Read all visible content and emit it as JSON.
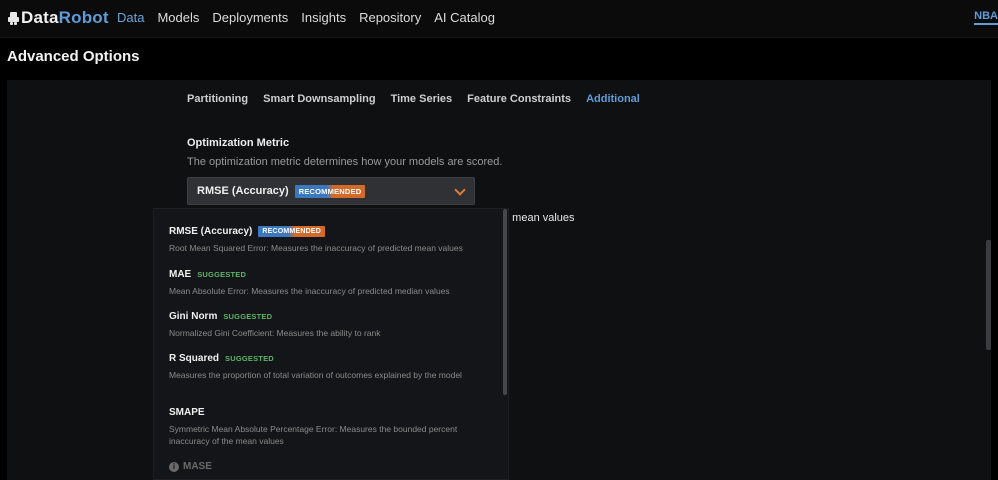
{
  "brand": {
    "part1": "Data",
    "part2": "Robot"
  },
  "nav": [
    "Data",
    "Models",
    "Deployments",
    "Insights",
    "Repository",
    "AI Catalog"
  ],
  "project": "NBA",
  "page_title": "Advanced Options",
  "tabs": [
    "Partitioning",
    "Smart Downsampling",
    "Time Series",
    "Feature Constraints",
    "Additional"
  ],
  "metric": {
    "label": "Optimization Metric",
    "description": "The optimization metric determines how your models are scored.",
    "selected": "RMSE (Accuracy)",
    "selected_badge": "RECOMMENDED",
    "behind_text": "d mean values"
  },
  "options": [
    {
      "title": "RMSE (Accuracy)",
      "tag": "RECOMMENDED",
      "desc": "Root Mean Squared Error: Measures the inaccuracy of predicted mean values"
    },
    {
      "title": "MAE",
      "tag": "SUGGESTED",
      "desc": "Mean Absolute Error: Measures the inaccuracy of predicted median values"
    },
    {
      "title": "Gini Norm",
      "tag": "SUGGESTED",
      "desc": "Normalized Gini Coefficient: Measures the ability to rank"
    },
    {
      "title": "R Squared",
      "tag": "SUGGESTED",
      "desc": "Measures the proportion of total variation of outcomes explained by the model"
    },
    {
      "title": "SMAPE",
      "tag": "",
      "desc": "Symmetric Mean Absolute Percentage Error: Measures the bounded percent inaccuracy of the mean values"
    },
    {
      "title": "MASE",
      "tag": "",
      "desc": ""
    }
  ],
  "colors": {
    "accent": "#5f9cd8",
    "suggested": "#5bb56a",
    "warning": "#e07a3a"
  }
}
